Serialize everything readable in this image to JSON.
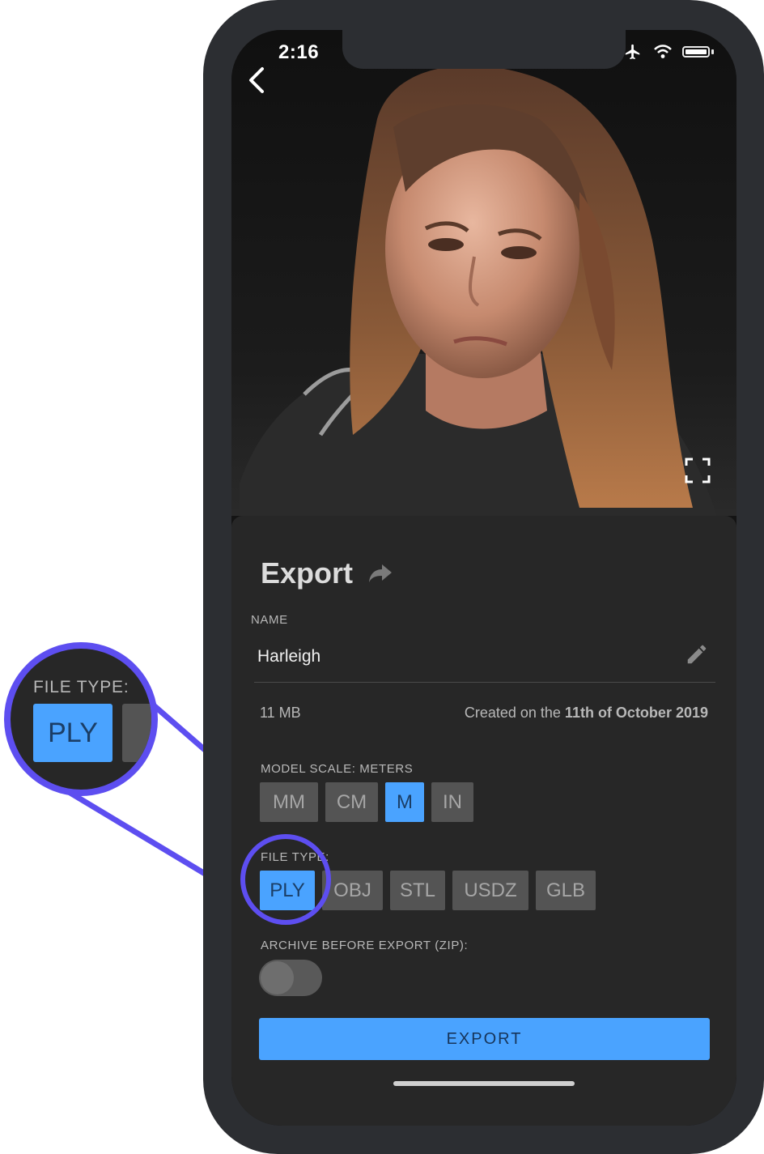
{
  "status_bar": {
    "time": "2:16"
  },
  "export_panel": {
    "title": "Export",
    "name_label": "NAME",
    "name_value": "Harleigh",
    "file_size": "11 MB",
    "created_prefix": "Created on the ",
    "created_date": "11th of October 2019",
    "model_scale_label": "MODEL SCALE: METERS",
    "scale_options": [
      "MM",
      "CM",
      "M",
      "IN"
    ],
    "selected_scale": "M",
    "file_type_label": "FILE TYPE:",
    "file_type_options": [
      "PLY",
      "OBJ",
      "STL",
      "USDZ",
      "GLB"
    ],
    "selected_file_type": "PLY",
    "archive_label": "ARCHIVE BEFORE EXPORT (ZIP):",
    "archive_enabled": false,
    "export_button": "EXPORT"
  },
  "magnifier": {
    "label": "FILE TYPE:",
    "button": "PLY"
  },
  "colors": {
    "accent": "#4aa3ff",
    "callout": "#5d4ef0",
    "panel": "#272727"
  }
}
